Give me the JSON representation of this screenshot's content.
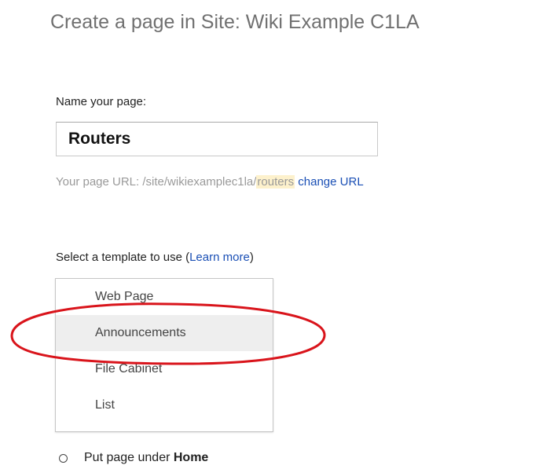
{
  "header": {
    "title": "Create a page in Site: Wiki Example C1LA"
  },
  "name_section": {
    "label": "Name your page:",
    "value": "Routers"
  },
  "url_section": {
    "prefix": "Your page URL: /site/wikiexamplec1la/",
    "slug": "routers",
    "change_link": "change URL"
  },
  "template_section": {
    "label_prefix": "Select a template to use (",
    "learn_more": "Learn more",
    "label_suffix": ")",
    "items": [
      {
        "label": "Web Page"
      },
      {
        "label": "Announcements",
        "selected": true
      },
      {
        "label": "File Cabinet"
      },
      {
        "label": "List"
      }
    ]
  },
  "annotation": {
    "ellipse_color": "#d9141b"
  },
  "location_section": {
    "radio_prefix": "Put page under ",
    "radio_target": "Home"
  }
}
